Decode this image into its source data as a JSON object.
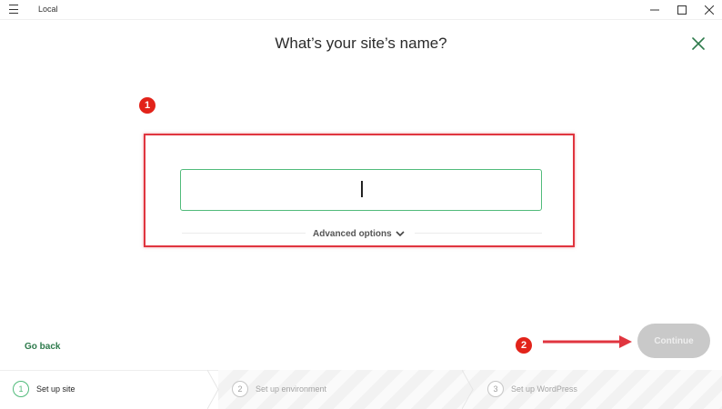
{
  "window": {
    "app_title": "Local"
  },
  "page": {
    "title": "What’s your site’s name?"
  },
  "form": {
    "site_name_value": "",
    "advanced_options_label": "Advanced options"
  },
  "callouts": [
    "1",
    "2"
  ],
  "footer": {
    "go_back_label": "Go back",
    "continue_label": "Continue"
  },
  "steps": [
    {
      "number": "1",
      "label": "Set up site",
      "state": "active"
    },
    {
      "number": "2",
      "label": "Set up environment",
      "state": "pending"
    },
    {
      "number": "3",
      "label": "Set up WordPress",
      "state": "pending"
    }
  ],
  "colors": {
    "accent_green": "#51bb7b",
    "annotation_red": "#e2231a",
    "disabled_button": "#c9c9c9"
  },
  "icons": [
    "hamburger-menu-icon",
    "minimize-icon",
    "maximize-icon",
    "close-window-icon",
    "close-x-icon",
    "chevron-down-icon",
    "arrow-right-icon"
  ]
}
